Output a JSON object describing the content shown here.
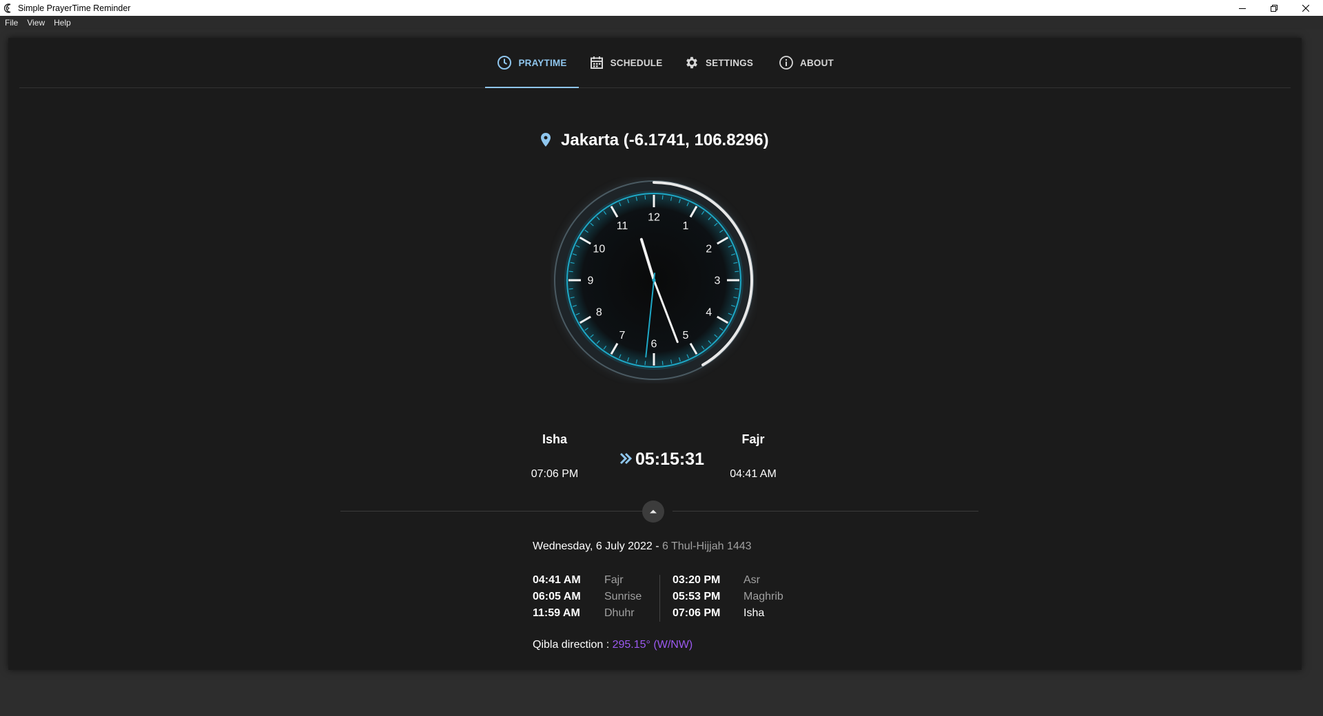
{
  "window": {
    "title": "Simple PrayerTime Reminder"
  },
  "menu": [
    "File",
    "View",
    "Help"
  ],
  "tabs": [
    {
      "label": "PRAYTIME",
      "icon": "clock-icon",
      "active": true
    },
    {
      "label": "SCHEDULE",
      "icon": "calendar-icon",
      "active": false
    },
    {
      "label": "SETTINGS",
      "icon": "gear-icon",
      "active": false
    },
    {
      "label": "ABOUT",
      "icon": "info-icon",
      "active": false
    }
  ],
  "location": {
    "text": "Jakarta (-6.1741, 106.8296)",
    "icon": "map-pin-icon"
  },
  "clock": {
    "numerals": [
      "12",
      "1",
      "2",
      "3",
      "4",
      "5",
      "6",
      "7",
      "8",
      "9",
      "10",
      "11"
    ],
    "time": {
      "hour": 11,
      "minute": 26,
      "second": 31
    },
    "accent_color": "#1ea8c6"
  },
  "current_prayer": {
    "name": "Isha",
    "time": "07:06 PM"
  },
  "next_prayer": {
    "name": "Fajr",
    "time": "04:41 AM"
  },
  "countdown": {
    "value": "05:15:31",
    "icon": "double-chevron-right-icon"
  },
  "date": {
    "gregorian": "Wednesday, 6 July 2022",
    "separator": " - ",
    "hijri": "6 Thul-Hijjah 1443"
  },
  "schedule": {
    "left": [
      {
        "time": "04:41 AM",
        "name": "Fajr"
      },
      {
        "time": "06:05 AM",
        "name": "Sunrise"
      },
      {
        "time": "11:59 AM",
        "name": "Dhuhr"
      }
    ],
    "right": [
      {
        "time": "03:20 PM",
        "name": "Asr"
      },
      {
        "time": "05:53 PM",
        "name": "Maghrib"
      },
      {
        "time": "07:06 PM",
        "name": "Isha"
      }
    ]
  },
  "qibla": {
    "label": "Qibla direction : ",
    "value": "295.15° (W/NW)",
    "value_color": "#9b59f0"
  },
  "colors": {
    "accent": "#8fc6ee",
    "background": "#1b1b1b"
  }
}
